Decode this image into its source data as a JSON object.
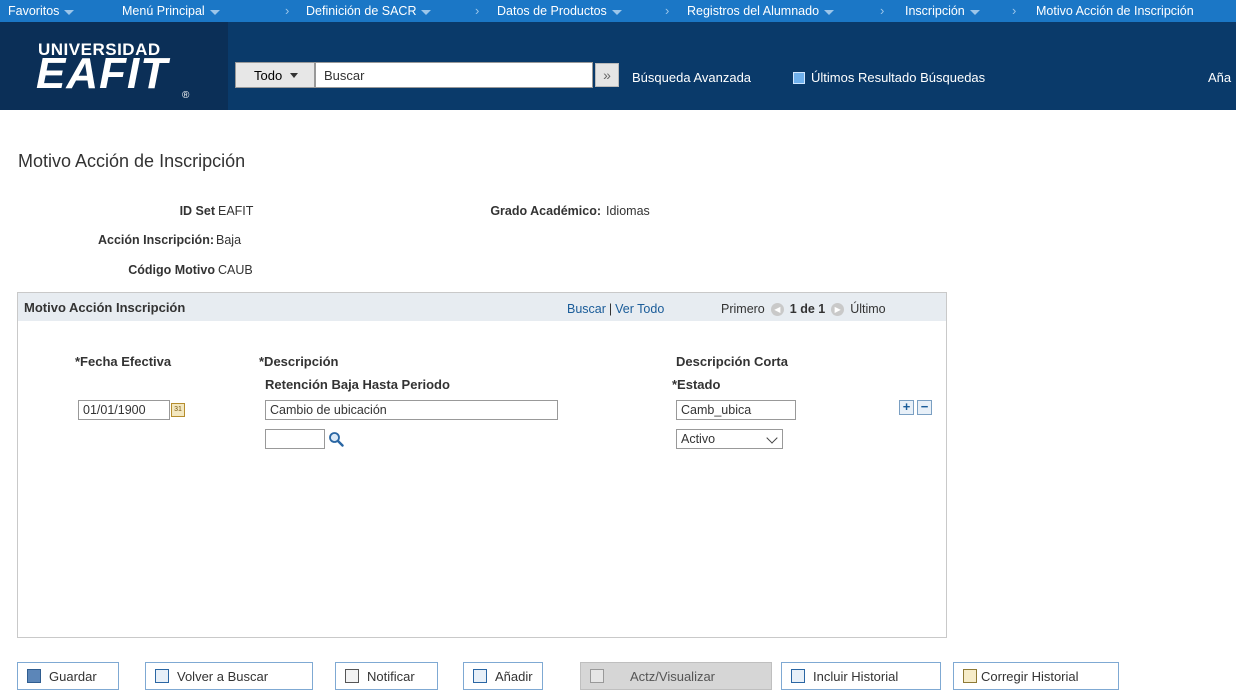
{
  "nav": {
    "favoritos": "Favoritos",
    "menu_principal": "Menú Principal",
    "crumbs": [
      "Definición de SACR",
      "Datos de Productos",
      "Registros del Alumnado",
      "Inscripción",
      "Motivo Acción de Inscripción"
    ]
  },
  "header": {
    "logo_top": "UNIVERSIDAD",
    "logo_main": "EAFIT",
    "logo_reg": "®",
    "search_category": "Todo",
    "search_placeholder": "Buscar",
    "advanced_search": "Búsqueda Avanzada",
    "last_results": "Últimos Resultado Búsquedas",
    "add_cut": "Aña"
  },
  "page": {
    "title": "Motivo Acción de Inscripción",
    "id_set_label": "ID Set",
    "id_set_value": "EAFIT",
    "grado_label": "Grado Académico:",
    "grado_value": "Idiomas",
    "accion_label": "Acción Inscripción:",
    "accion_value": "Baja",
    "codigo_label": "Código Motivo",
    "codigo_value": "CAUB"
  },
  "grid": {
    "title": "Motivo Acción Inscripción",
    "buscar": "Buscar",
    "ver_todo": "Ver Todo",
    "primero": "Primero",
    "count": "1 de 1",
    "ultimo": "Último",
    "col_fecha": "*Fecha Efectiva",
    "col_descripcion": "*Descripción",
    "col_retencion": "Retención Baja Hasta Periodo",
    "col_desc_corta": "Descripción Corta",
    "col_estado": "*Estado",
    "fecha_value": "01/01/1900",
    "descripcion_value": "Cambio de ubicación",
    "retencion_value": "",
    "desc_corta_value": "Camb_ubica",
    "estado_value": "Activo"
  },
  "toolbar": {
    "guardar": "Guardar",
    "volver": "Volver a Buscar",
    "notificar": "Notificar",
    "anadir": "Añadir",
    "actz": "Actz/Visualizar",
    "incluir": "Incluir Historial",
    "corregir": "Corregir Historial"
  },
  "colors": {
    "nav_bg": "#1b77c6",
    "header_bg": "#0a3a6a",
    "grid_header_bg": "#e7ecf1",
    "link": "#1a5c99"
  }
}
